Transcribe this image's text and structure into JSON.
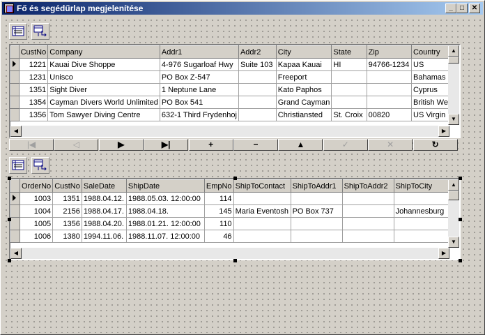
{
  "window": {
    "title": "Fő és segédűrlap megjelenítése"
  },
  "title_buttons": {
    "minimize": "_",
    "maximize": "□",
    "close": "✕"
  },
  "master_grid": {
    "columns": [
      "CustNo",
      "Company",
      "Addr1",
      "Addr2",
      "City",
      "State",
      "Zip",
      "Country"
    ],
    "rows": [
      [
        "1221",
        "Kauai Dive Shoppe",
        "4-976 Sugarloaf Hwy",
        "Suite 103",
        "Kapaa Kauai",
        "HI",
        "94766-1234",
        "US"
      ],
      [
        "1231",
        "Unisco",
        "PO Box Z-547",
        "",
        "Freeport",
        "",
        "",
        "Bahamas"
      ],
      [
        "1351",
        "Sight Diver",
        "1 Neptune Lane",
        "",
        "Kato Paphos",
        "",
        "",
        "Cyprus"
      ],
      [
        "1354",
        "Cayman Divers World Unlimited",
        "PO Box 541",
        "",
        "Grand Cayman",
        "",
        "",
        "British West"
      ],
      [
        "1356",
        "Tom Sawyer Diving Centre",
        "632-1 Third Frydenhoj",
        "",
        "Christiansted",
        "St. Croix",
        "00820",
        "US Virgin Is"
      ]
    ]
  },
  "navigator": {
    "buttons": [
      {
        "name": "nav-first-button",
        "glyph": "|◀",
        "enabled": false
      },
      {
        "name": "nav-prior-button",
        "glyph": "◁",
        "enabled": false
      },
      {
        "name": "nav-next-button",
        "glyph": "▶",
        "enabled": true
      },
      {
        "name": "nav-last-button",
        "glyph": "▶|",
        "enabled": true
      },
      {
        "name": "nav-insert-button",
        "glyph": "+",
        "enabled": true
      },
      {
        "name": "nav-delete-button",
        "glyph": "−",
        "enabled": true
      },
      {
        "name": "nav-edit-button",
        "glyph": "▲",
        "enabled": true
      },
      {
        "name": "nav-post-button",
        "glyph": "✓",
        "enabled": false
      },
      {
        "name": "nav-cancel-button",
        "glyph": "✕",
        "enabled": false
      },
      {
        "name": "nav-refresh-button",
        "glyph": "↻",
        "enabled": true
      }
    ]
  },
  "detail_grid": {
    "columns": [
      "OrderNo",
      "CustNo",
      "SaleDate",
      "ShipDate",
      "EmpNo",
      "ShipToContact",
      "ShipToAddr1",
      "ShipToAddr2",
      "ShipToCity"
    ],
    "rows": [
      [
        "1003",
        "1351",
        "1988.04.12.",
        "1988.05.03. 12:00:00",
        "114",
        "",
        "",
        "",
        ""
      ],
      [
        "1004",
        "2156",
        "1988.04.17.",
        "1988.04.18.",
        "145",
        "Maria Eventosh",
        "PO Box 737",
        "",
        "Johannesburg"
      ],
      [
        "1005",
        "1356",
        "1988.04.20.",
        "1988.01.21. 12:00:00",
        "110",
        "",
        "",
        "",
        ""
      ],
      [
        "1006",
        "1380",
        "1994.11.06.",
        "1988.11.07. 12:00:00",
        "46",
        "",
        "",
        "",
        ""
      ]
    ]
  }
}
